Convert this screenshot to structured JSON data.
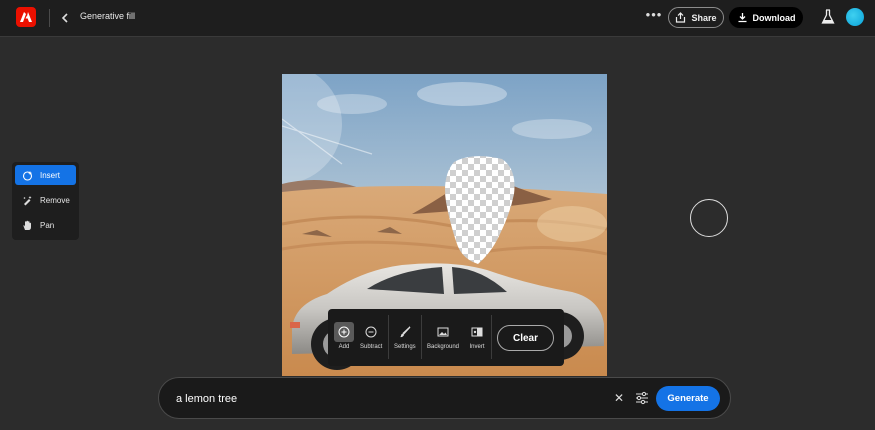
{
  "header": {
    "title": "Generative fill",
    "more_label": "•••",
    "share_label": "Share",
    "download_label": "Download"
  },
  "tools": {
    "items": [
      {
        "label": "Insert",
        "icon": "insert-icon",
        "active": true
      },
      {
        "label": "Remove",
        "icon": "remove-icon",
        "active": false
      },
      {
        "label": "Pan",
        "icon": "hand-icon",
        "active": false
      }
    ]
  },
  "brush_toolbar": {
    "add_label": "Add",
    "subtract_label": "Subtract",
    "settings_label": "Settings",
    "background_label": "Background",
    "invert_label": "Invert",
    "clear_label": "Clear"
  },
  "prompt": {
    "value": "a lemon tree",
    "clear_symbol": "✕",
    "generate_label": "Generate"
  },
  "colors": {
    "accent": "#1473e6",
    "brand": "#eb1000",
    "background": "#2c2c2c",
    "panel": "#1e1e1e"
  }
}
